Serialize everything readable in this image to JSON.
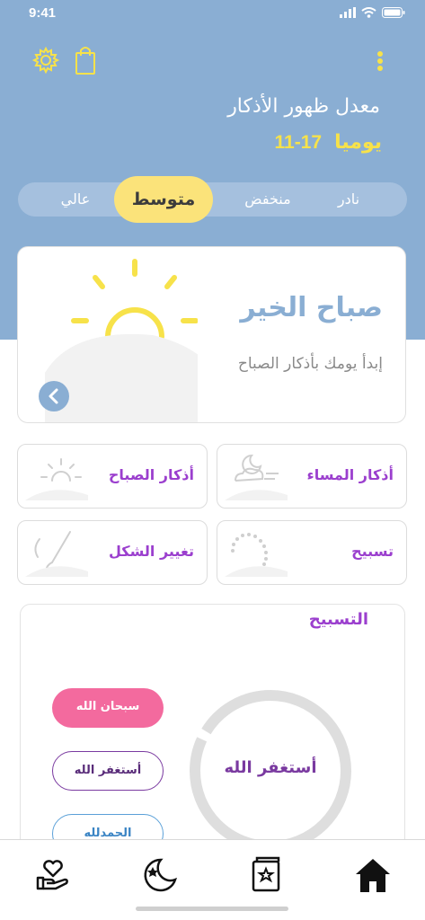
{
  "status_bar": {
    "time": "9:41",
    "icons": [
      "signal-icon",
      "wifi-icon",
      "battery-icon"
    ]
  },
  "header": {
    "settings_icon": "gear-icon",
    "bag_icon": "shopping-bag-icon",
    "menu_icon": "more-vertical-icon",
    "title": "معدل ظهور الأذكار",
    "daily_label": "يوميا",
    "daily_range": "11-17"
  },
  "frequency": {
    "options": [
      "نادر",
      "منخفض",
      "متوسط",
      "عالي"
    ],
    "selected": "متوسط"
  },
  "hero": {
    "title": "صباح الخير",
    "subtitle": "إبدأ يومك بأذكار الصباح",
    "icon": "sun-icon"
  },
  "cards": [
    {
      "label": "أذكار المساء",
      "icon": "night-cloud-icon"
    },
    {
      "label": "أذكار الصباح",
      "icon": "sun-icon"
    },
    {
      "label": "تسبيح",
      "icon": "prayer-beads-icon"
    },
    {
      "label": "تغيير الشكل",
      "icon": "brush-icon"
    }
  ],
  "tasbih": {
    "title": "التسبيح",
    "center_text": "أستغفر الله",
    "buttons": [
      "سبحان الله",
      "أستغفر الله",
      "الحمدلله"
    ]
  },
  "bottom_nav": {
    "items": [
      "heart-hand-icon",
      "moon-star-icon",
      "book-star-icon",
      "home-icon"
    ],
    "active": "home-icon"
  },
  "colors": {
    "header_blue": "#8aaed3",
    "accent_yellow": "#fbe37a",
    "text_yellow": "#f7e24a",
    "purple": "#9b3fce",
    "pink": "#f36a9e"
  }
}
